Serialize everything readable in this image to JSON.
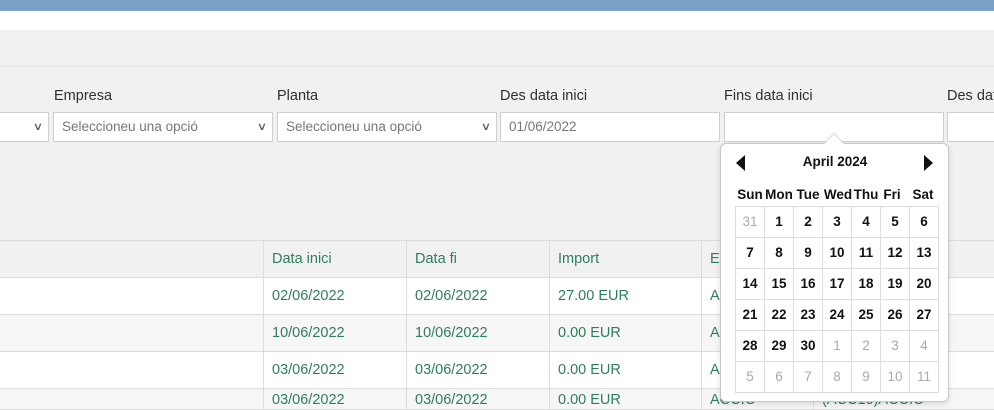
{
  "filters": {
    "empresa": {
      "label": "Empresa",
      "placeholder": "Seleccioneu una opció"
    },
    "planta": {
      "label": "Planta",
      "placeholder": "Seleccioneu una opció"
    },
    "des_data_inici": {
      "label": "Des data inici",
      "value": "01/06/2022"
    },
    "fins_data_inici": {
      "label": "Fins data inici",
      "value": ""
    },
    "des_data_fi": {
      "label": "Des data fi"
    }
  },
  "table": {
    "headers": [
      "Data inici",
      "Data fi",
      "Import",
      "Estat"
    ],
    "rows": [
      {
        "data_inici": "02/06/2022",
        "data_fi": "02/06/2022",
        "import": "27.00 EUR",
        "estat": "ACCIO"
      },
      {
        "data_inici": "10/06/2022",
        "data_fi": "10/06/2022",
        "import": "0.00 EUR",
        "estat": "ACCIO"
      },
      {
        "data_inici": "03/06/2022",
        "data_fi": "03/06/2022",
        "import": "0.00 EUR",
        "estat": "ACCIO"
      },
      {
        "data_inici": "03/06/2022",
        "data_fi": "03/06/2022",
        "import": "0.00 EUR",
        "estat": "ACCIO",
        "extra": "(ACC10)ACCIO"
      }
    ]
  },
  "calendar": {
    "title": "April 2024",
    "weekdays": [
      "Sun",
      "Mon",
      "Tue",
      "Wed",
      "Thu",
      "Fri",
      "Sat"
    ],
    "weeks": [
      [
        "31",
        "1",
        "2",
        "3",
        "4",
        "5",
        "6"
      ],
      [
        "7",
        "8",
        "9",
        "10",
        "11",
        "12",
        "13"
      ],
      [
        "14",
        "15",
        "16",
        "17",
        "18",
        "19",
        "20"
      ],
      [
        "21",
        "22",
        "23",
        "24",
        "25",
        "26",
        "27"
      ],
      [
        "28",
        "29",
        "30",
        "1",
        "2",
        "3",
        "4"
      ],
      [
        "5",
        "6",
        "7",
        "8",
        "9",
        "10",
        "11"
      ]
    ],
    "other_month": [
      [
        true,
        false,
        false,
        false,
        false,
        false,
        false
      ],
      [
        false,
        false,
        false,
        false,
        false,
        false,
        false
      ],
      [
        false,
        false,
        false,
        false,
        false,
        false,
        false
      ],
      [
        false,
        false,
        false,
        false,
        false,
        false,
        false
      ],
      [
        false,
        false,
        false,
        true,
        true,
        true,
        true
      ],
      [
        true,
        true,
        true,
        true,
        true,
        true,
        true
      ]
    ],
    "prev_icon": "triangle-left-icon",
    "next_icon": "triangle-right-icon"
  },
  "colors": {
    "topbar": "#7aa0c8",
    "table_text": "#2e7d5b",
    "filter_bg": "#f1f1f1"
  }
}
